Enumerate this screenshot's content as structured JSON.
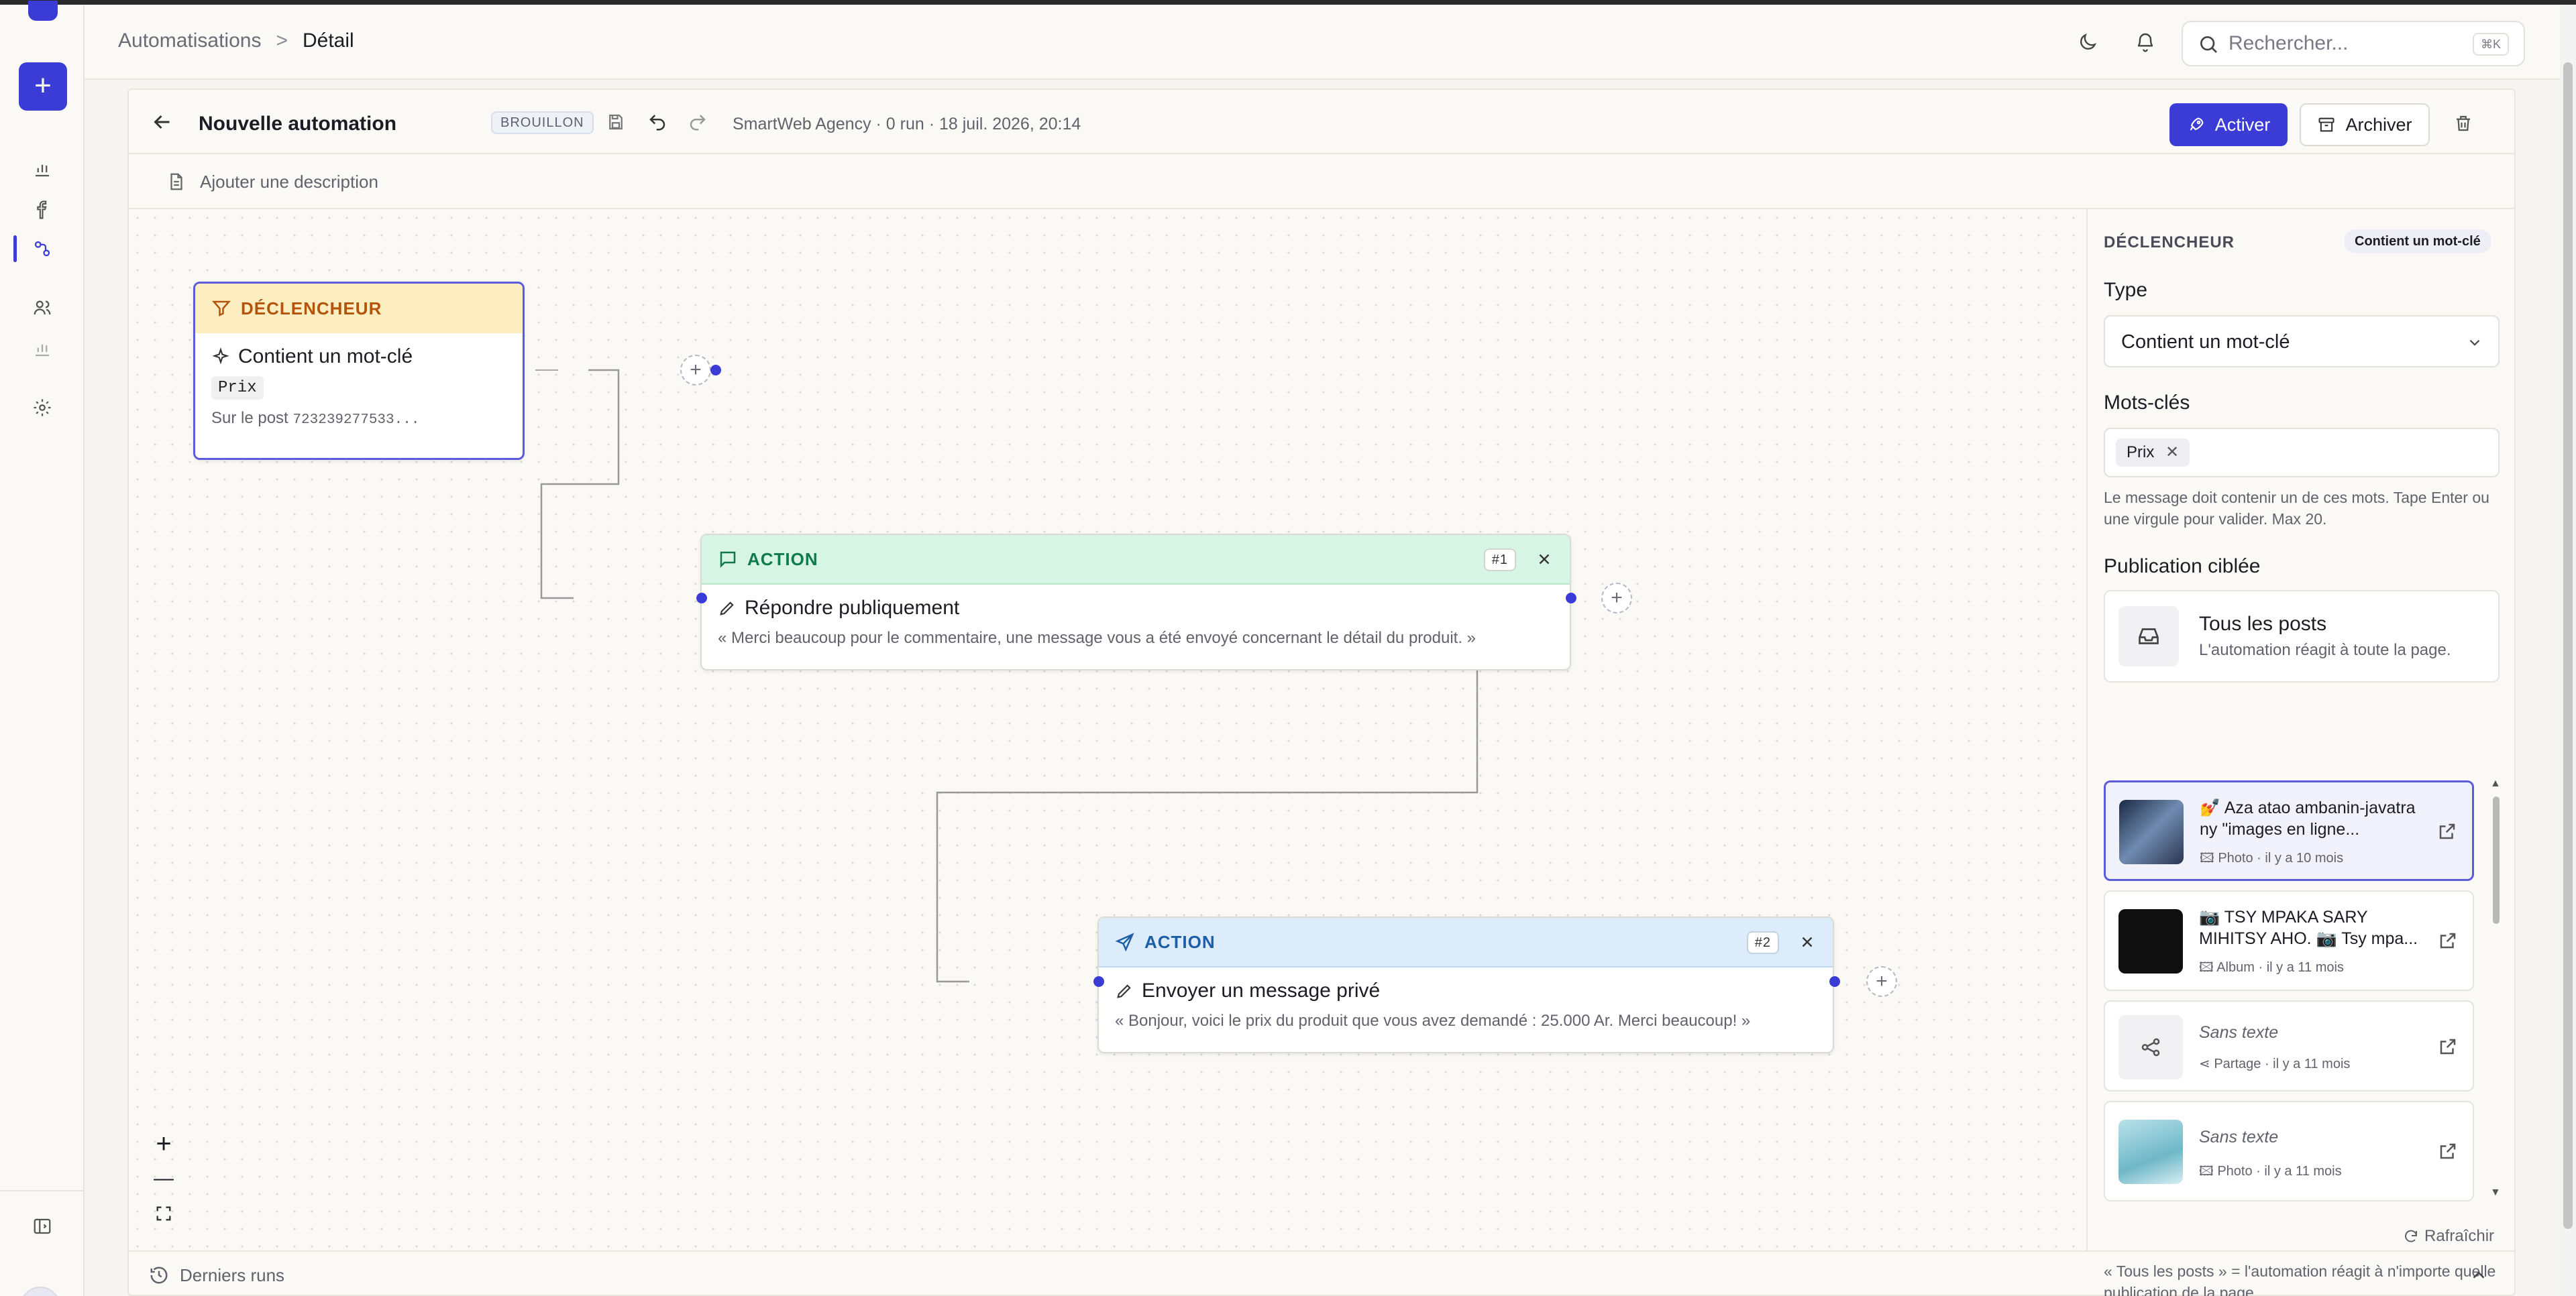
{
  "header": {
    "breadcrumb": {
      "parent": "Automatisations",
      "separator": ">",
      "current": "Détail"
    },
    "search": {
      "placeholder": "Rechercher...",
      "shortcut": "⌘K"
    }
  },
  "toolbar": {
    "title": "Nouvelle automation",
    "status": "BROUILLON",
    "meta": "SmartWeb Agency · 0 run · 18 juil. 2026, 20:14",
    "activate_label": "Activer",
    "archive_label": "Archiver"
  },
  "description": {
    "add_label": "Ajouter une description"
  },
  "canvas": {
    "trigger": {
      "header": "DÉCLENCHEUR",
      "title": "Contient un mot-clé",
      "keyword": "Prix",
      "post_prefix": "Sur le post",
      "post_id": "723239277533..."
    },
    "action1": {
      "header": "ACTION",
      "number": "#1",
      "title": "Répondre publiquement",
      "message": "« Merci beaucoup pour le commentaire, une message vous a été envoyé concernant le détail du produit. »"
    },
    "action2": {
      "header": "ACTION",
      "number": "#2",
      "title": "Envoyer un message privé",
      "message": "« Bonjour, voici le prix du produit que vous avez demandé : 25.000 Ar. Merci beaucoup! »"
    },
    "zoom": {
      "in": "+",
      "out": "—"
    }
  },
  "panel": {
    "section_label": "DÉCLENCHEUR",
    "section_pill": "Contient un mot-clé",
    "type_label": "Type",
    "type_value": "Contient un mot-clé",
    "keywords_label": "Mots-clés",
    "keywords": [
      "Prix"
    ],
    "keywords_help": "Le message doit contenir un de ces mots. Tape Enter ou une virgule pour valider. Max 20.",
    "target_label": "Publication ciblée",
    "all_posts": {
      "title": "Tous les posts",
      "subtitle": "L'automation réagit à toute la page."
    },
    "posts": [
      {
        "title": "💅 Aza atao ambanin-javatra ny \"images en ligne...",
        "kind": "Photo",
        "age": "il y a 10 mois",
        "selected": true
      },
      {
        "title": "📷 TSY MPAKA SARY MIHITSY AHO. 📷 Tsy mpa...",
        "kind": "Album",
        "age": "il y a 11 mois",
        "selected": false
      },
      {
        "title": "Sans texte",
        "kind": "Partage",
        "age": "il y a 11 mois",
        "selected": false
      },
      {
        "title": "Sans texte",
        "kind": "Photo",
        "age": "il y a 11 mois",
        "selected": false
      }
    ],
    "refresh_label": "Rafraîchir",
    "footer_help": "« Tous les posts » = l'automation réagit à n'importe quelle publication de la page."
  },
  "bottom": {
    "runs_label": "Derniers runs"
  },
  "colors": {
    "accent": "#3b3bd6",
    "trigger_header": "#fdeec2",
    "action1_header": "#d6f5e4",
    "action2_header": "#dcecfb"
  }
}
